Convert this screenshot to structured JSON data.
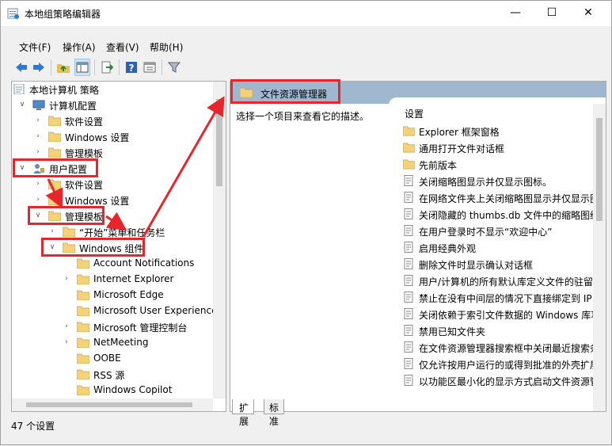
{
  "window": {
    "title": "本地组策略编辑器"
  },
  "menubar": {
    "items": [
      "文件(F)",
      "操作(A)",
      "查看(V)",
      "帮助(H)"
    ]
  },
  "toolbar": {
    "icons": [
      "back-icon",
      "forward-icon",
      "up-folder-icon",
      "show-hide-tree-icon",
      "export-list-icon",
      "help-icon",
      "properties-icon",
      "filter-icon"
    ]
  },
  "tree": {
    "items": [
      {
        "label": "本地计算机 策略",
        "level": 0,
        "chevron": "",
        "icon": "policy"
      },
      {
        "label": "计算机配置",
        "level": 1,
        "chevron": "down",
        "icon": "computer"
      },
      {
        "label": "软件设置",
        "level": 2,
        "chevron": "right",
        "icon": "folder"
      },
      {
        "label": "Windows 设置",
        "level": 2,
        "chevron": "right",
        "icon": "folder"
      },
      {
        "label": "管理模板",
        "level": 2,
        "chevron": "right",
        "icon": "folder"
      },
      {
        "label": "用户配置",
        "level": 1,
        "chevron": "down",
        "icon": "user"
      },
      {
        "label": "软件设置",
        "level": 2,
        "chevron": "right",
        "icon": "folder"
      },
      {
        "label": "Windows 设置",
        "level": 2,
        "chevron": "right",
        "icon": "folder"
      },
      {
        "label": "管理模板",
        "level": 2,
        "chevron": "down",
        "icon": "folder-open"
      },
      {
        "label": "“开始”菜单和任务栏",
        "level": 3,
        "chevron": "right",
        "icon": "folder"
      },
      {
        "label": "Windows 组件",
        "level": 3,
        "chevron": "down",
        "icon": "folder-open"
      },
      {
        "label": "Account Notifications",
        "level": 4,
        "chevron": "",
        "icon": "folder"
      },
      {
        "label": "Internet Explorer",
        "level": 4,
        "chevron": "right",
        "icon": "folder"
      },
      {
        "label": "Microsoft Edge",
        "level": 4,
        "chevron": "",
        "icon": "folder"
      },
      {
        "label": "Microsoft User Experience",
        "level": 4,
        "chevron": "",
        "icon": "folder"
      },
      {
        "label": "Microsoft 管理控制台",
        "level": 4,
        "chevron": "right",
        "icon": "folder"
      },
      {
        "label": "NetMeeting",
        "level": 4,
        "chevron": "right",
        "icon": "folder"
      },
      {
        "label": "OOBE",
        "level": 4,
        "chevron": "",
        "icon": "folder"
      },
      {
        "label": "RSS 源",
        "level": 4,
        "chevron": "",
        "icon": "folder"
      },
      {
        "label": "Windows Copilot",
        "level": 4,
        "chevron": "",
        "icon": "folder"
      }
    ]
  },
  "right": {
    "header": "文件资源管理器",
    "description": "选择一个项目来查看它的描述。",
    "column": "设置",
    "rows": [
      {
        "label": "Explorer 框架窗格",
        "icon": "folder"
      },
      {
        "label": "通用打开文件对话框",
        "icon": "folder"
      },
      {
        "label": "先前版本",
        "icon": "folder"
      },
      {
        "label": "关闭缩略图显示并仅显示图标。",
        "icon": "setting"
      },
      {
        "label": "在网络文件夹上关闭缩略图显示并仅显示图",
        "icon": "setting"
      },
      {
        "label": "关闭隐藏的 thumbs.db 文件中的缩略图缓",
        "icon": "setting"
      },
      {
        "label": "在用户登录时不显示“欢迎中心”",
        "icon": "setting"
      },
      {
        "label": "启用经典外观",
        "icon": "setting"
      },
      {
        "label": "删除文件时显示确认对话框",
        "icon": "setting"
      },
      {
        "label": "用户/计算机的所有默认库定义文件的驻留",
        "icon": "setting"
      },
      {
        "label": "禁止在没有中间层的情况下直接绑定到 IP",
        "icon": "setting"
      },
      {
        "label": "关闭依赖于索引文件数据的 Windows 库功",
        "icon": "setting"
      },
      {
        "label": "禁用已知文件夹",
        "icon": "setting"
      },
      {
        "label": "在文件资源管理器搜索框中关闭最近搜索条",
        "icon": "setting"
      },
      {
        "label": "仅允许按用户运行的或得到批准的外壳扩展",
        "icon": "setting"
      },
      {
        "label": "以功能区最小化的显示方式启动文件资源管",
        "icon": "setting"
      }
    ]
  },
  "tabs": [
    "扩展",
    "标准"
  ],
  "status": "47 个设置",
  "colors": {
    "highlight": "#e8252a",
    "header": "#9fb8d0",
    "folder": "#f5d27a"
  }
}
